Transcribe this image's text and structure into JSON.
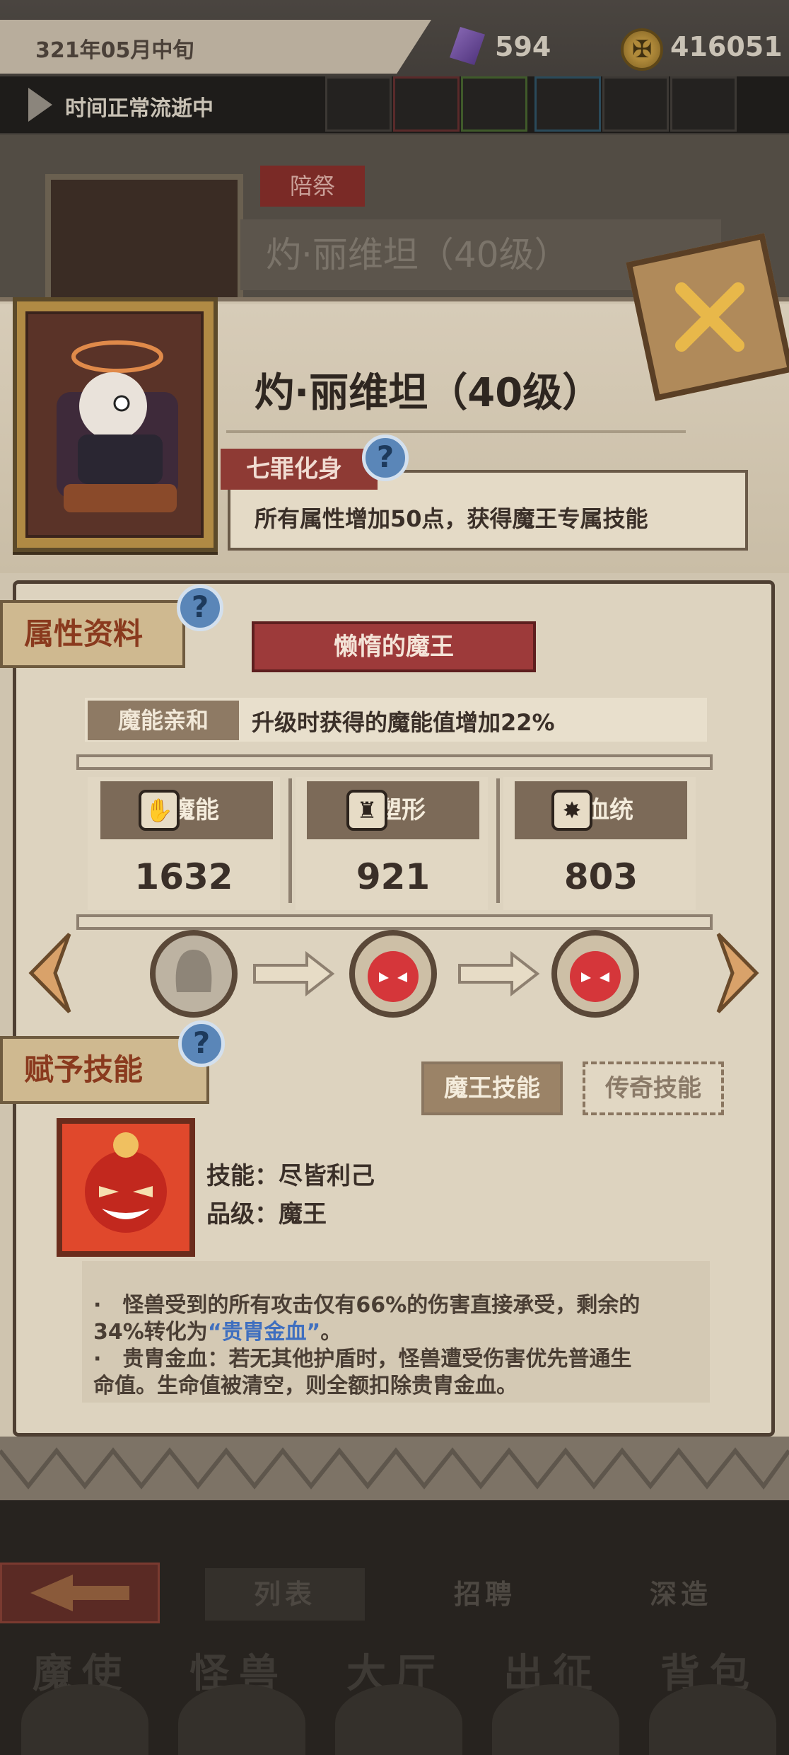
{
  "status_bar": {
    "date": "321年05月中旬",
    "gems": "594",
    "gold": "416051",
    "time_status": "时间正常流逝中"
  },
  "background": {
    "tag": "陪祭",
    "title": "灼·丽维坦（40级）"
  },
  "hero": {
    "name": "灼·丽维坦（40级）",
    "trait_tag": "七罪化身",
    "trait_desc": "所有属性增加50点，获得魔王专属技能"
  },
  "attributes": {
    "section_label": "属性资料",
    "class_ribbon": "懒惰的魔王",
    "affinity_tag": "魔能亲和",
    "affinity_desc": "升级时获得的魔能值增加22%",
    "stats": [
      {
        "label": "魔能",
        "value": "1632",
        "icon": "magic-claw-icon"
      },
      {
        "label": "塑形",
        "value": "921",
        "icon": "body-shape-icon"
      },
      {
        "label": "血统",
        "value": "803",
        "icon": "bloodline-icon"
      }
    ]
  },
  "skills": {
    "section_label": "赋予技能",
    "tabs": [
      "魔王技能",
      "传奇技能"
    ],
    "skill_name_line": "技能：尽皆利己",
    "skill_grade_line": "品级：魔王",
    "desc_line1_a": "·　怪兽受到的所有攻击仅有66%的伤害直接承受，剩余的",
    "desc_line1_b": "34%转化为",
    "desc_highlight": "“贵胄金血”",
    "desc_line1_c": "。",
    "desc_line2_a": "·　贵胄金血：若无其他护盾时，怪兽遭受伤害优先普通生",
    "desc_line2_b": "命值。生命值被清空，则全额扣除贵胄金血。"
  },
  "bottom": {
    "tabs": [
      "列表",
      "招聘",
      "深造"
    ],
    "nav": [
      "魔使",
      "怪兽",
      "大厅",
      "出征",
      "背包"
    ]
  },
  "colors": {
    "accent_red": "#9d3a3a",
    "help_blue": "#5a86b8",
    "highlight_blue": "#3f6fbf",
    "parchment": "#ddd3bf"
  }
}
